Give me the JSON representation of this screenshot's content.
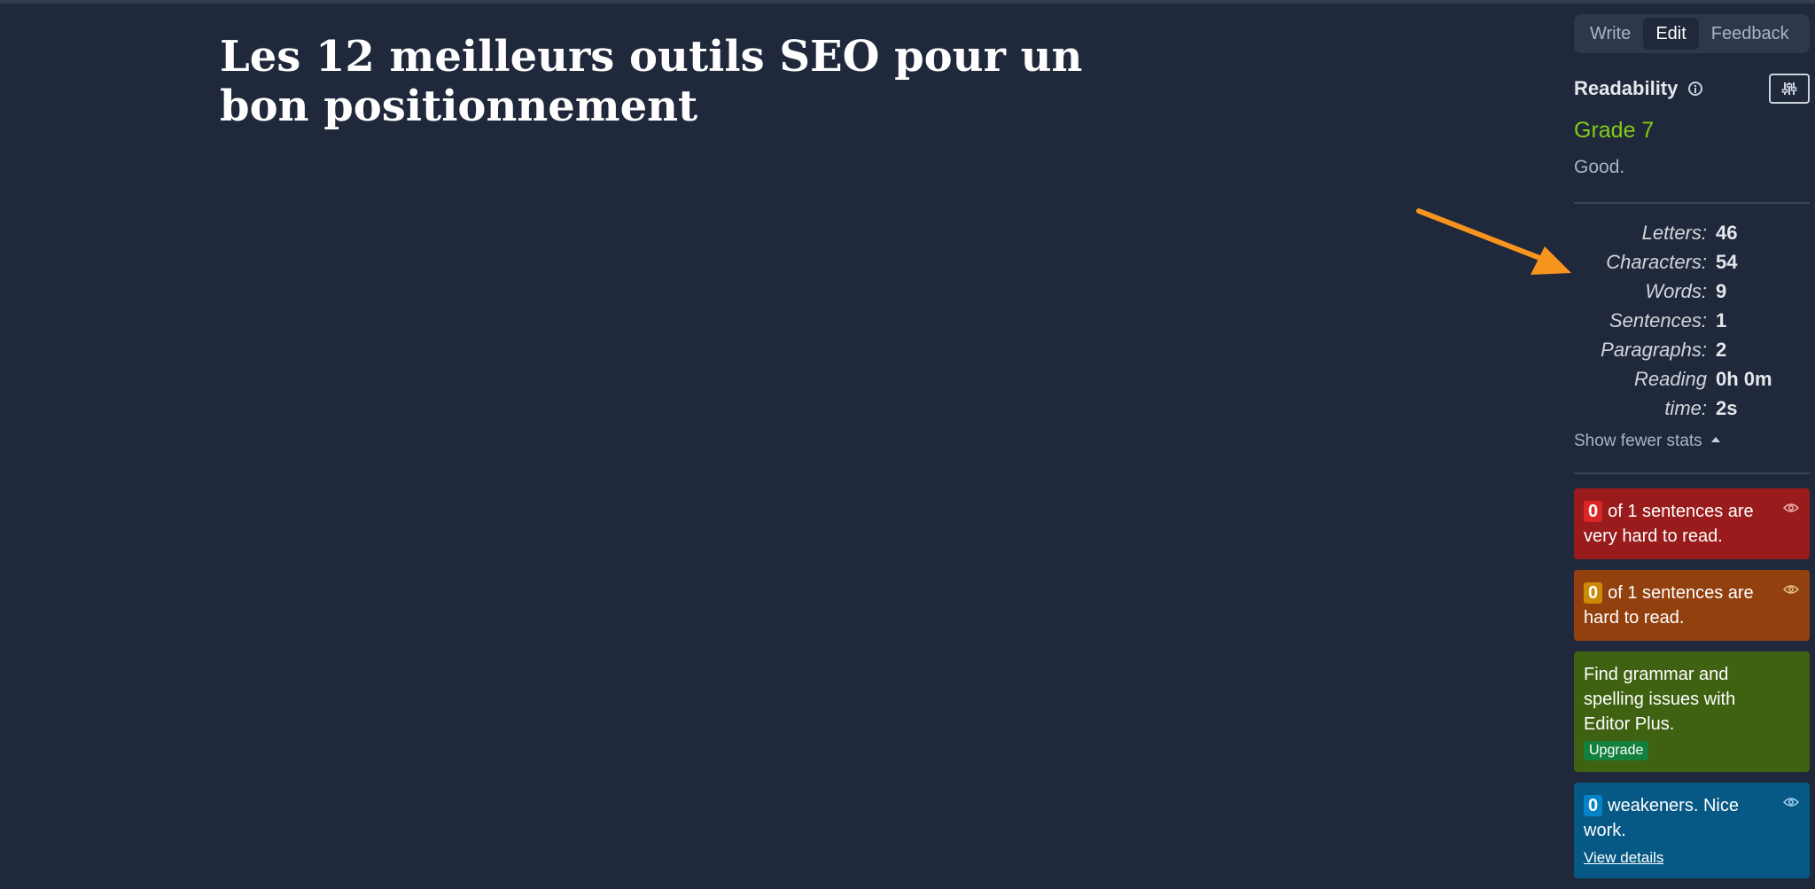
{
  "document": {
    "title": "Les 12 meilleurs outils SEO pour un bon positionnement"
  },
  "sidebar": {
    "tabs": [
      {
        "label": "Write"
      },
      {
        "label": "Edit"
      },
      {
        "label": "Feedback"
      }
    ],
    "readability": {
      "label": "Readability",
      "grade": "Grade 7",
      "description": "Good."
    },
    "stats": [
      {
        "label": "Letters:",
        "value": "46"
      },
      {
        "label": "Characters:",
        "value": "54"
      },
      {
        "label": "Words:",
        "value": "9"
      },
      {
        "label": "Sentences:",
        "value": "1"
      },
      {
        "label": "Paragraphs:",
        "value": "2"
      },
      {
        "label": "Reading",
        "value": "0h 0m"
      },
      {
        "label": "time:",
        "value": "2s"
      }
    ],
    "toggle_stats_label": "Show fewer stats",
    "cards": {
      "very_hard": {
        "count": "0",
        "text": "of 1 sentences are very hard to read."
      },
      "hard": {
        "count": "0",
        "text": "of 1 sentences are hard to read."
      },
      "grammar": {
        "text": "Find grammar and spelling issues with Editor Plus.",
        "upgrade_label": "Upgrade"
      },
      "weakeners": {
        "count": "0",
        "text": "weakeners. Nice work.",
        "link_label": "View details"
      }
    }
  },
  "colors": {
    "background": "#1f293b",
    "grade": "#84cc16",
    "arrow": "#f7941d"
  },
  "icons": [
    "info-icon",
    "sliders-icon",
    "eye-icon",
    "caret-up-icon",
    "arrow-annotation"
  ]
}
